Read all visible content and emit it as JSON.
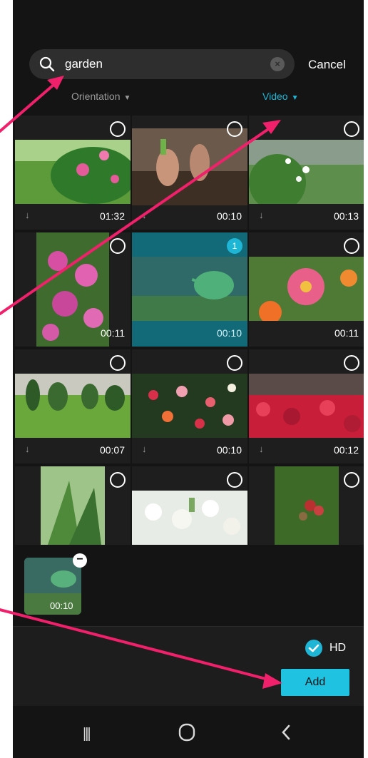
{
  "search": {
    "query": "garden",
    "cancel_label": "Cancel",
    "clear_icon": "clear-icon"
  },
  "filters": {
    "orientation_label": "Orientation",
    "type_label": "Video",
    "active_color": "#1fb6d6"
  },
  "grid": {
    "tiles": [
      {
        "duration": "01:32",
        "downloadable": true,
        "selected": false,
        "subject": "pink flower bush"
      },
      {
        "duration": "00:10",
        "downloadable": true,
        "selected": false,
        "subject": "hands in soil"
      },
      {
        "duration": "00:13",
        "downloadable": true,
        "selected": false,
        "subject": "white wildflowers"
      },
      {
        "duration": "00:11",
        "downloadable": false,
        "selected": false,
        "subject": "pink flowering shrub"
      },
      {
        "duration": "00:10",
        "downloadable": false,
        "selected": true,
        "selection_number": "1",
        "subject": "watering can"
      },
      {
        "duration": "00:11",
        "downloadable": false,
        "selected": false,
        "subject": "bee on zinnia"
      },
      {
        "duration": "00:07",
        "downloadable": true,
        "selected": false,
        "subject": "hedges on lawn"
      },
      {
        "duration": "00:10",
        "downloadable": true,
        "selected": false,
        "subject": "rose garden"
      },
      {
        "duration": "00:12",
        "downloadable": true,
        "selected": false,
        "subject": "red flower field"
      },
      {
        "duration": "",
        "downloadable": false,
        "selected": false,
        "subject": "green leaves"
      },
      {
        "duration": "",
        "downloadable": false,
        "selected": false,
        "subject": "white blossoms"
      },
      {
        "duration": "",
        "downloadable": false,
        "selected": false,
        "subject": "berries on plant"
      }
    ]
  },
  "tray": {
    "items": [
      {
        "duration": "00:10"
      }
    ]
  },
  "footer": {
    "hd_label": "HD",
    "hd_checked": true,
    "add_label": "Add"
  },
  "navbar": {
    "recent_glyph": "|||",
    "home_glyph": "○",
    "back_glyph": "<"
  },
  "colors": {
    "accent": "#1fb6d6",
    "annotation_arrow": "#f0206a"
  }
}
